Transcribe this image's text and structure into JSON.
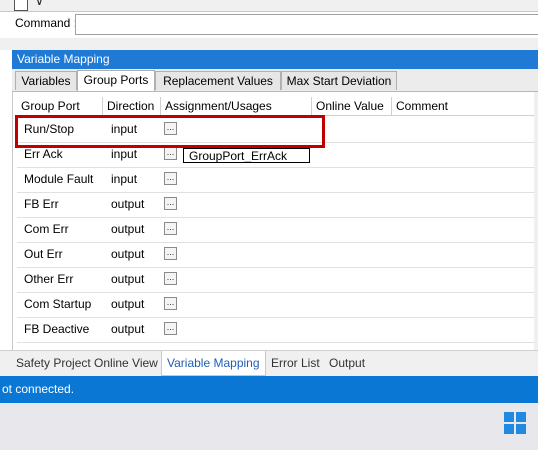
{
  "command": {
    "label": "Command :",
    "value": ""
  },
  "panel": {
    "title": "Variable Mapping",
    "tabs": [
      {
        "label": "Variables",
        "active": false
      },
      {
        "label": "Group Ports",
        "active": true
      },
      {
        "label": "Replacement Values",
        "active": false
      },
      {
        "label": "Max Start Deviation",
        "active": false
      }
    ],
    "columns": [
      "Group Port",
      "Direction",
      "Assignment/Usages",
      "Online Value",
      "Comment"
    ],
    "rows": [
      {
        "port": "Run/Stop",
        "direction": "input",
        "assignment": ""
      },
      {
        "port": "Err Ack",
        "direction": "input",
        "assignment": "GroupPort_ErrAck"
      },
      {
        "port": "Module Fault",
        "direction": "input",
        "assignment": ""
      },
      {
        "port": "FB Err",
        "direction": "output",
        "assignment": ""
      },
      {
        "port": "Com Err",
        "direction": "output",
        "assignment": ""
      },
      {
        "port": "Out Err",
        "direction": "output",
        "assignment": ""
      },
      {
        "port": "Other Err",
        "direction": "output",
        "assignment": ""
      },
      {
        "port": "Com Startup",
        "direction": "output",
        "assignment": ""
      },
      {
        "port": "FB Deactive",
        "direction": "output",
        "assignment": ""
      }
    ],
    "ellipsis": "..."
  },
  "bottom_tabs": [
    {
      "label": "Safety Project Online View",
      "active": false
    },
    {
      "label": "Variable Mapping",
      "active": true
    },
    {
      "label": "Error List",
      "active": false
    },
    {
      "label": "Output",
      "active": false
    }
  ],
  "status": {
    "text": "ot connected."
  },
  "colors": {
    "accent": "#1f7ad6",
    "status": "#0a77d4",
    "highlight": "#c00000"
  },
  "icons": {
    "taskbar": "windows-logo-icon",
    "assign": "ellipsis-icon"
  }
}
